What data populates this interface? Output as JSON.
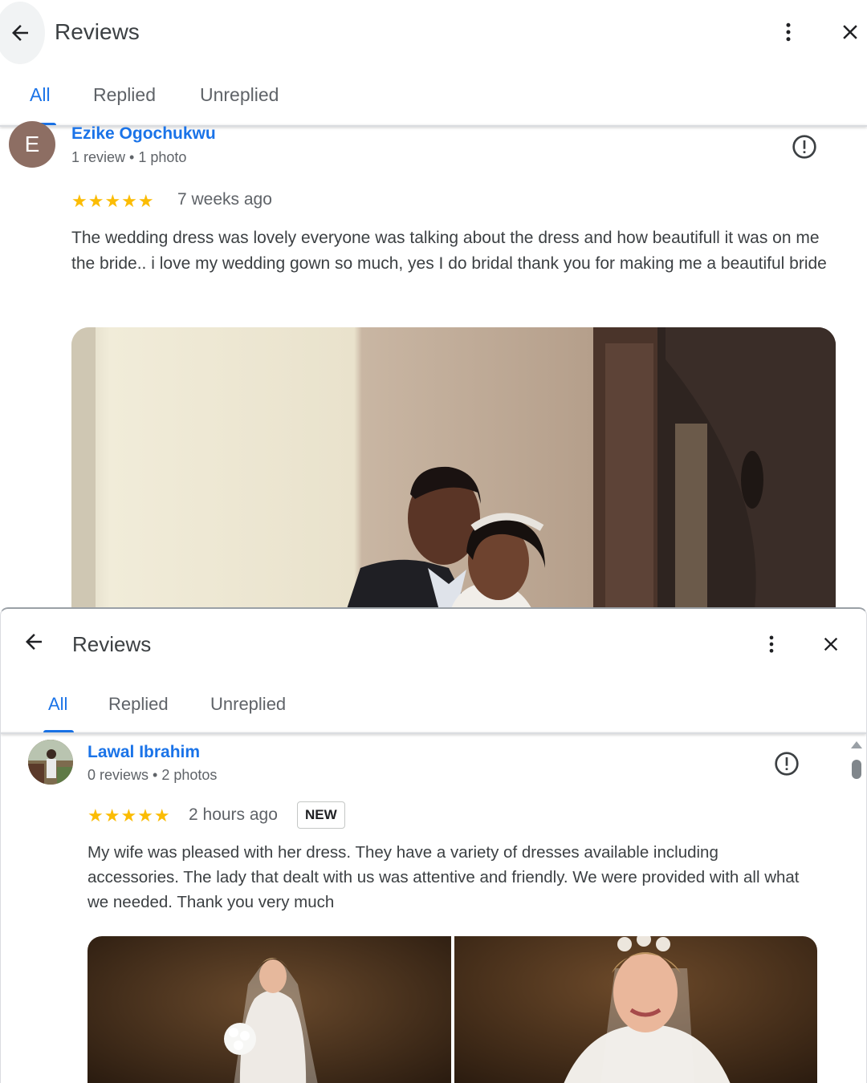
{
  "panels": [
    {
      "header": {
        "title": "Reviews"
      },
      "tabs": [
        "All",
        "Replied",
        "Unreplied"
      ],
      "review": {
        "avatar_letter": "E",
        "avatar_color": "#8d6e63",
        "name": "Ezike Ogochukwu",
        "meta": "1 review • 1 photo",
        "rating": 5,
        "stars": "★★★★★",
        "time": "7 weeks ago",
        "text": "The wedding dress was lovely everyone was talking about the dress and how beautifull it was on me the bride.. i love my wedding gown so much, yes I do bridal thank you for making me a beautiful bride"
      }
    },
    {
      "header": {
        "title": "Reviews"
      },
      "tabs": [
        "All",
        "Replied",
        "Unreplied"
      ],
      "review": {
        "name": "Lawal Ibrahim",
        "meta": "0 reviews • 2 photos",
        "rating": 5,
        "stars": "★★★★★",
        "time": "2 hours ago",
        "badge": "NEW",
        "text": "My wife was pleased with her dress. They have a variety of dresses available including accessories. The lady that dealt with us was attentive and friendly. We were provided with all what we needed. Thank you very much"
      }
    }
  ],
  "colors": {
    "accent": "#1a73e8",
    "star": "#fbbc04",
    "text": "#3c4043",
    "muted": "#5f6368"
  },
  "icons": [
    "arrow-back-icon",
    "more-vert-icon",
    "close-icon",
    "report-flag-icon"
  ]
}
